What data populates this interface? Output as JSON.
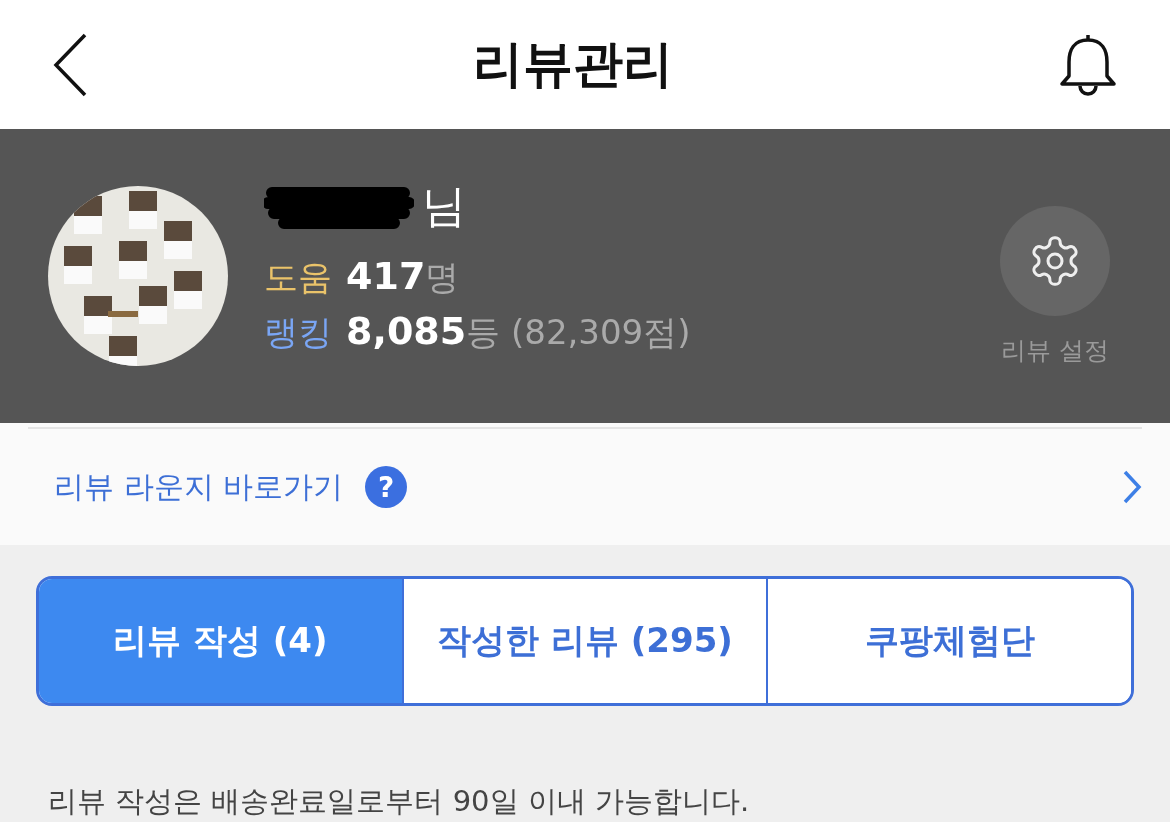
{
  "header": {
    "title": "리뷰관리"
  },
  "profile": {
    "name": "님",
    "help": {
      "label": "도움",
      "value": "417",
      "unit": "명"
    },
    "ranking": {
      "label": "랭킹",
      "value": "8,085",
      "unit": "등",
      "points": "(82,309점)"
    },
    "settings_label": "리뷰 설정"
  },
  "lounge": {
    "label": "리뷰 라운지 바로가기",
    "help_icon": "?"
  },
  "tabs": [
    {
      "label": "리뷰 작성 (4)",
      "selected": true
    },
    {
      "label": "작성한 리뷰 (295)",
      "selected": false
    },
    {
      "label": "쿠팡체험단",
      "selected": false
    }
  ],
  "notice": "리뷰 작성은 배송완료일로부터 90일 이내 가능합니다."
}
